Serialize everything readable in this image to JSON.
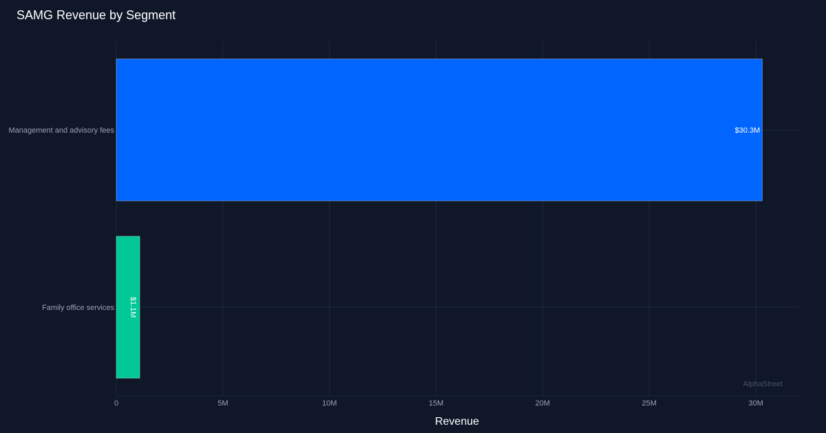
{
  "chart_data": {
    "type": "bar",
    "orientation": "horizontal",
    "title": "SAMG Revenue by Segment",
    "xlabel": "Revenue",
    "ylabel": "",
    "categories": [
      "Management and advisory fees",
      "Family office services"
    ],
    "values": [
      30300000,
      1100000
    ],
    "data_labels": [
      "$30.3M",
      "$1.1M"
    ],
    "colors": [
      "#0066ff",
      "#00c896"
    ],
    "xlim": [
      0,
      32000000
    ],
    "xticks": [
      0,
      5000000,
      10000000,
      15000000,
      20000000,
      25000000,
      30000000
    ],
    "xtick_labels": [
      "0",
      "5M",
      "10M",
      "15M",
      "20M",
      "25M",
      "30M"
    ],
    "grid": true,
    "legend": "none"
  },
  "watermark": "AlphaStreet"
}
